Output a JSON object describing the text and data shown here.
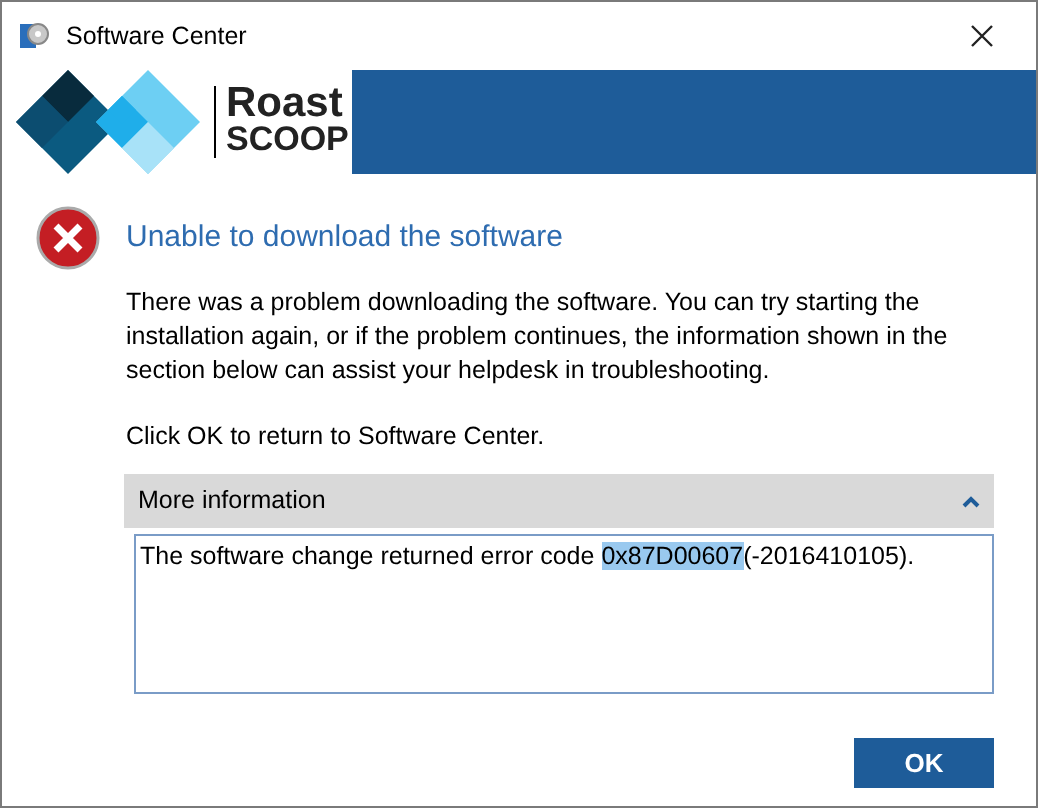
{
  "window": {
    "title": "Software Center"
  },
  "banner": {
    "logo_line_1": "Roast",
    "logo_line_2": "SCOOP"
  },
  "dialog": {
    "heading": "Unable to download the software",
    "message": "There was a problem downloading the software.  You can try starting the installation again, or if the problem continues, the information shown in the section below can assist your helpdesk in troubleshooting.",
    "instruction": "Click OK to return to Software Center."
  },
  "more_information": {
    "label": "More information",
    "expanded": true,
    "text": {
      "before": "The software change returned error code ",
      "selected": "0x87D00607",
      "after": "(-2016410105)."
    }
  },
  "buttons": [
    {
      "label": "OK"
    }
  ]
}
